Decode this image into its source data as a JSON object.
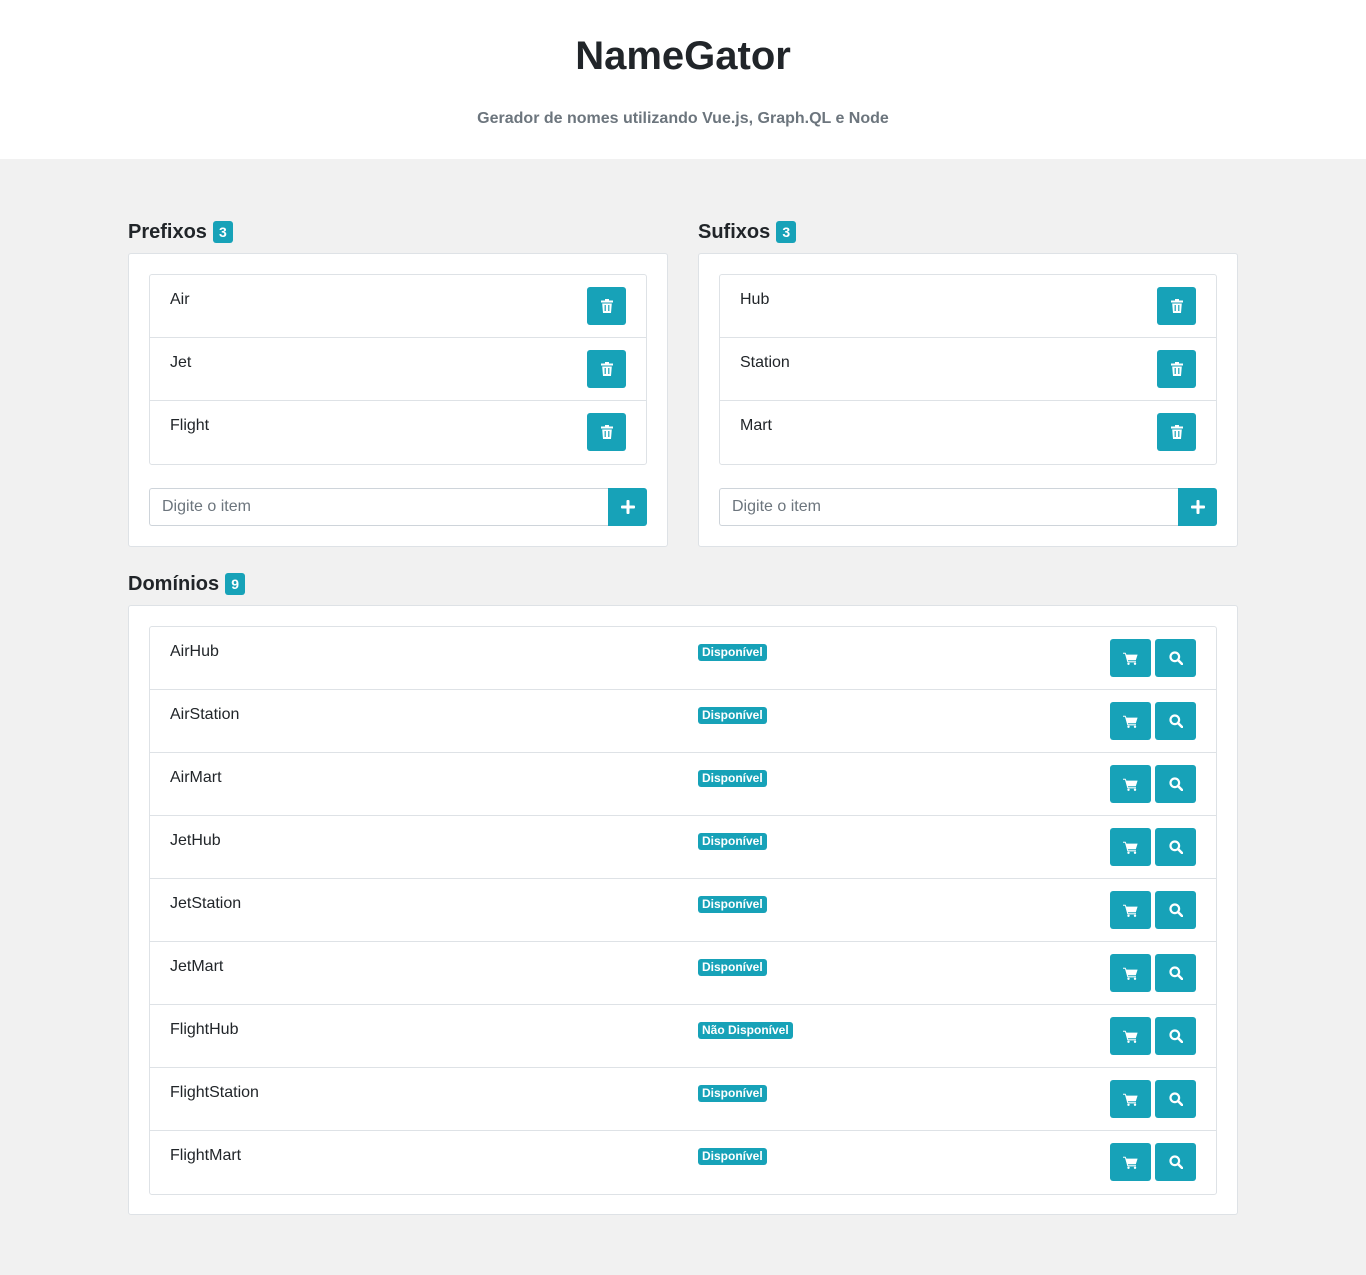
{
  "header": {
    "title": "NameGator",
    "subtitle": "Gerador de nomes utilizando Vue.js, Graph.QL e Node"
  },
  "prefixes": {
    "title": "Prefixos",
    "count": "3",
    "items": [
      "Air",
      "Jet",
      "Flight"
    ],
    "input_placeholder": "Digite o item"
  },
  "suffixes": {
    "title": "Sufixos",
    "count": "3",
    "items": [
      "Hub",
      "Station",
      "Mart"
    ],
    "input_placeholder": "Digite o item"
  },
  "domains": {
    "title": "Domínios",
    "count": "9",
    "items": [
      {
        "name": "AirHub",
        "status": "Disponível"
      },
      {
        "name": "AirStation",
        "status": "Disponível"
      },
      {
        "name": "AirMart",
        "status": "Disponível"
      },
      {
        "name": "JetHub",
        "status": "Disponível"
      },
      {
        "name": "JetStation",
        "status": "Disponível"
      },
      {
        "name": "JetMart",
        "status": "Disponível"
      },
      {
        "name": "FlightHub",
        "status": "Não Disponível"
      },
      {
        "name": "FlightStation",
        "status": "Disponível"
      },
      {
        "name": "FlightMart",
        "status": "Disponível"
      }
    ]
  },
  "colors": {
    "accent": "#17a2b8",
    "background": "#f1f1f1"
  },
  "icons": {
    "delete": "trash-icon",
    "add": "plus-icon",
    "buy": "cart-icon",
    "search": "search-icon"
  }
}
